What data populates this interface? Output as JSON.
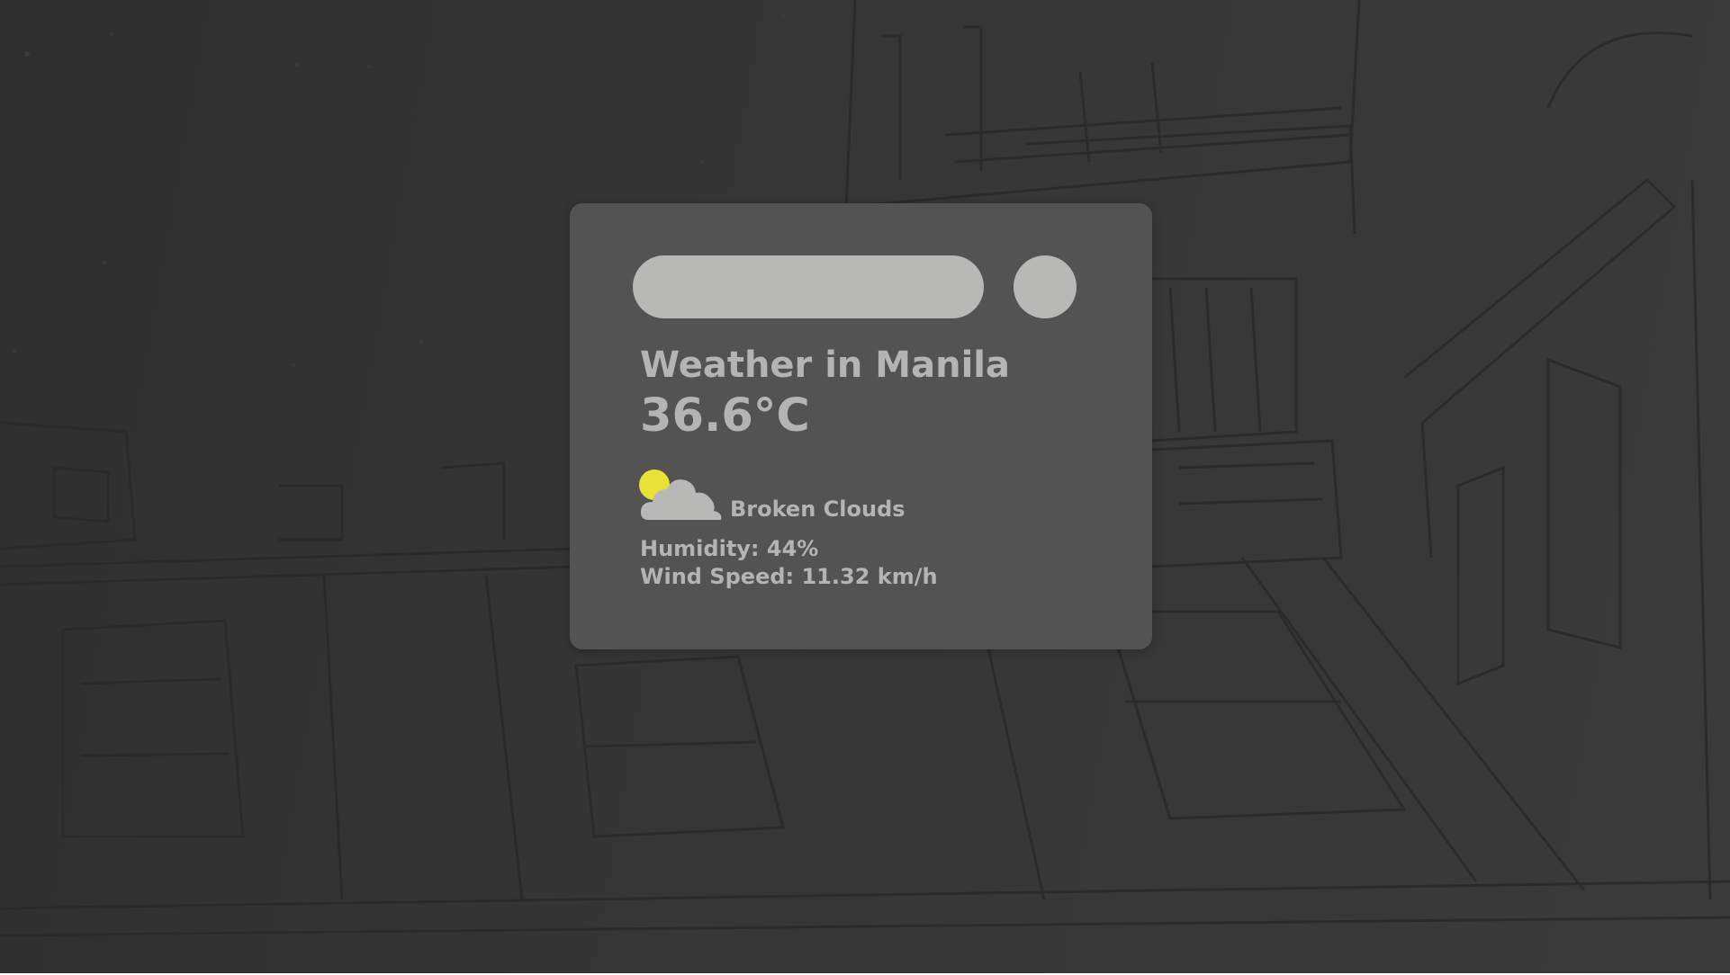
{
  "search": {
    "value": "",
    "placeholder": ""
  },
  "weather": {
    "title": "Weather in Manila",
    "temperature": "36.6°C",
    "description": "Broken Clouds",
    "humidity": "Humidity: 44%",
    "wind": "Wind Speed: 11.32 km/h",
    "icon": "broken-clouds-sun-icon"
  },
  "colors": {
    "card": "#535353",
    "input": "#b8b8b7",
    "text": "#b4b4b4",
    "sun": "#e8e236",
    "cloud": "#b8b8b7"
  }
}
